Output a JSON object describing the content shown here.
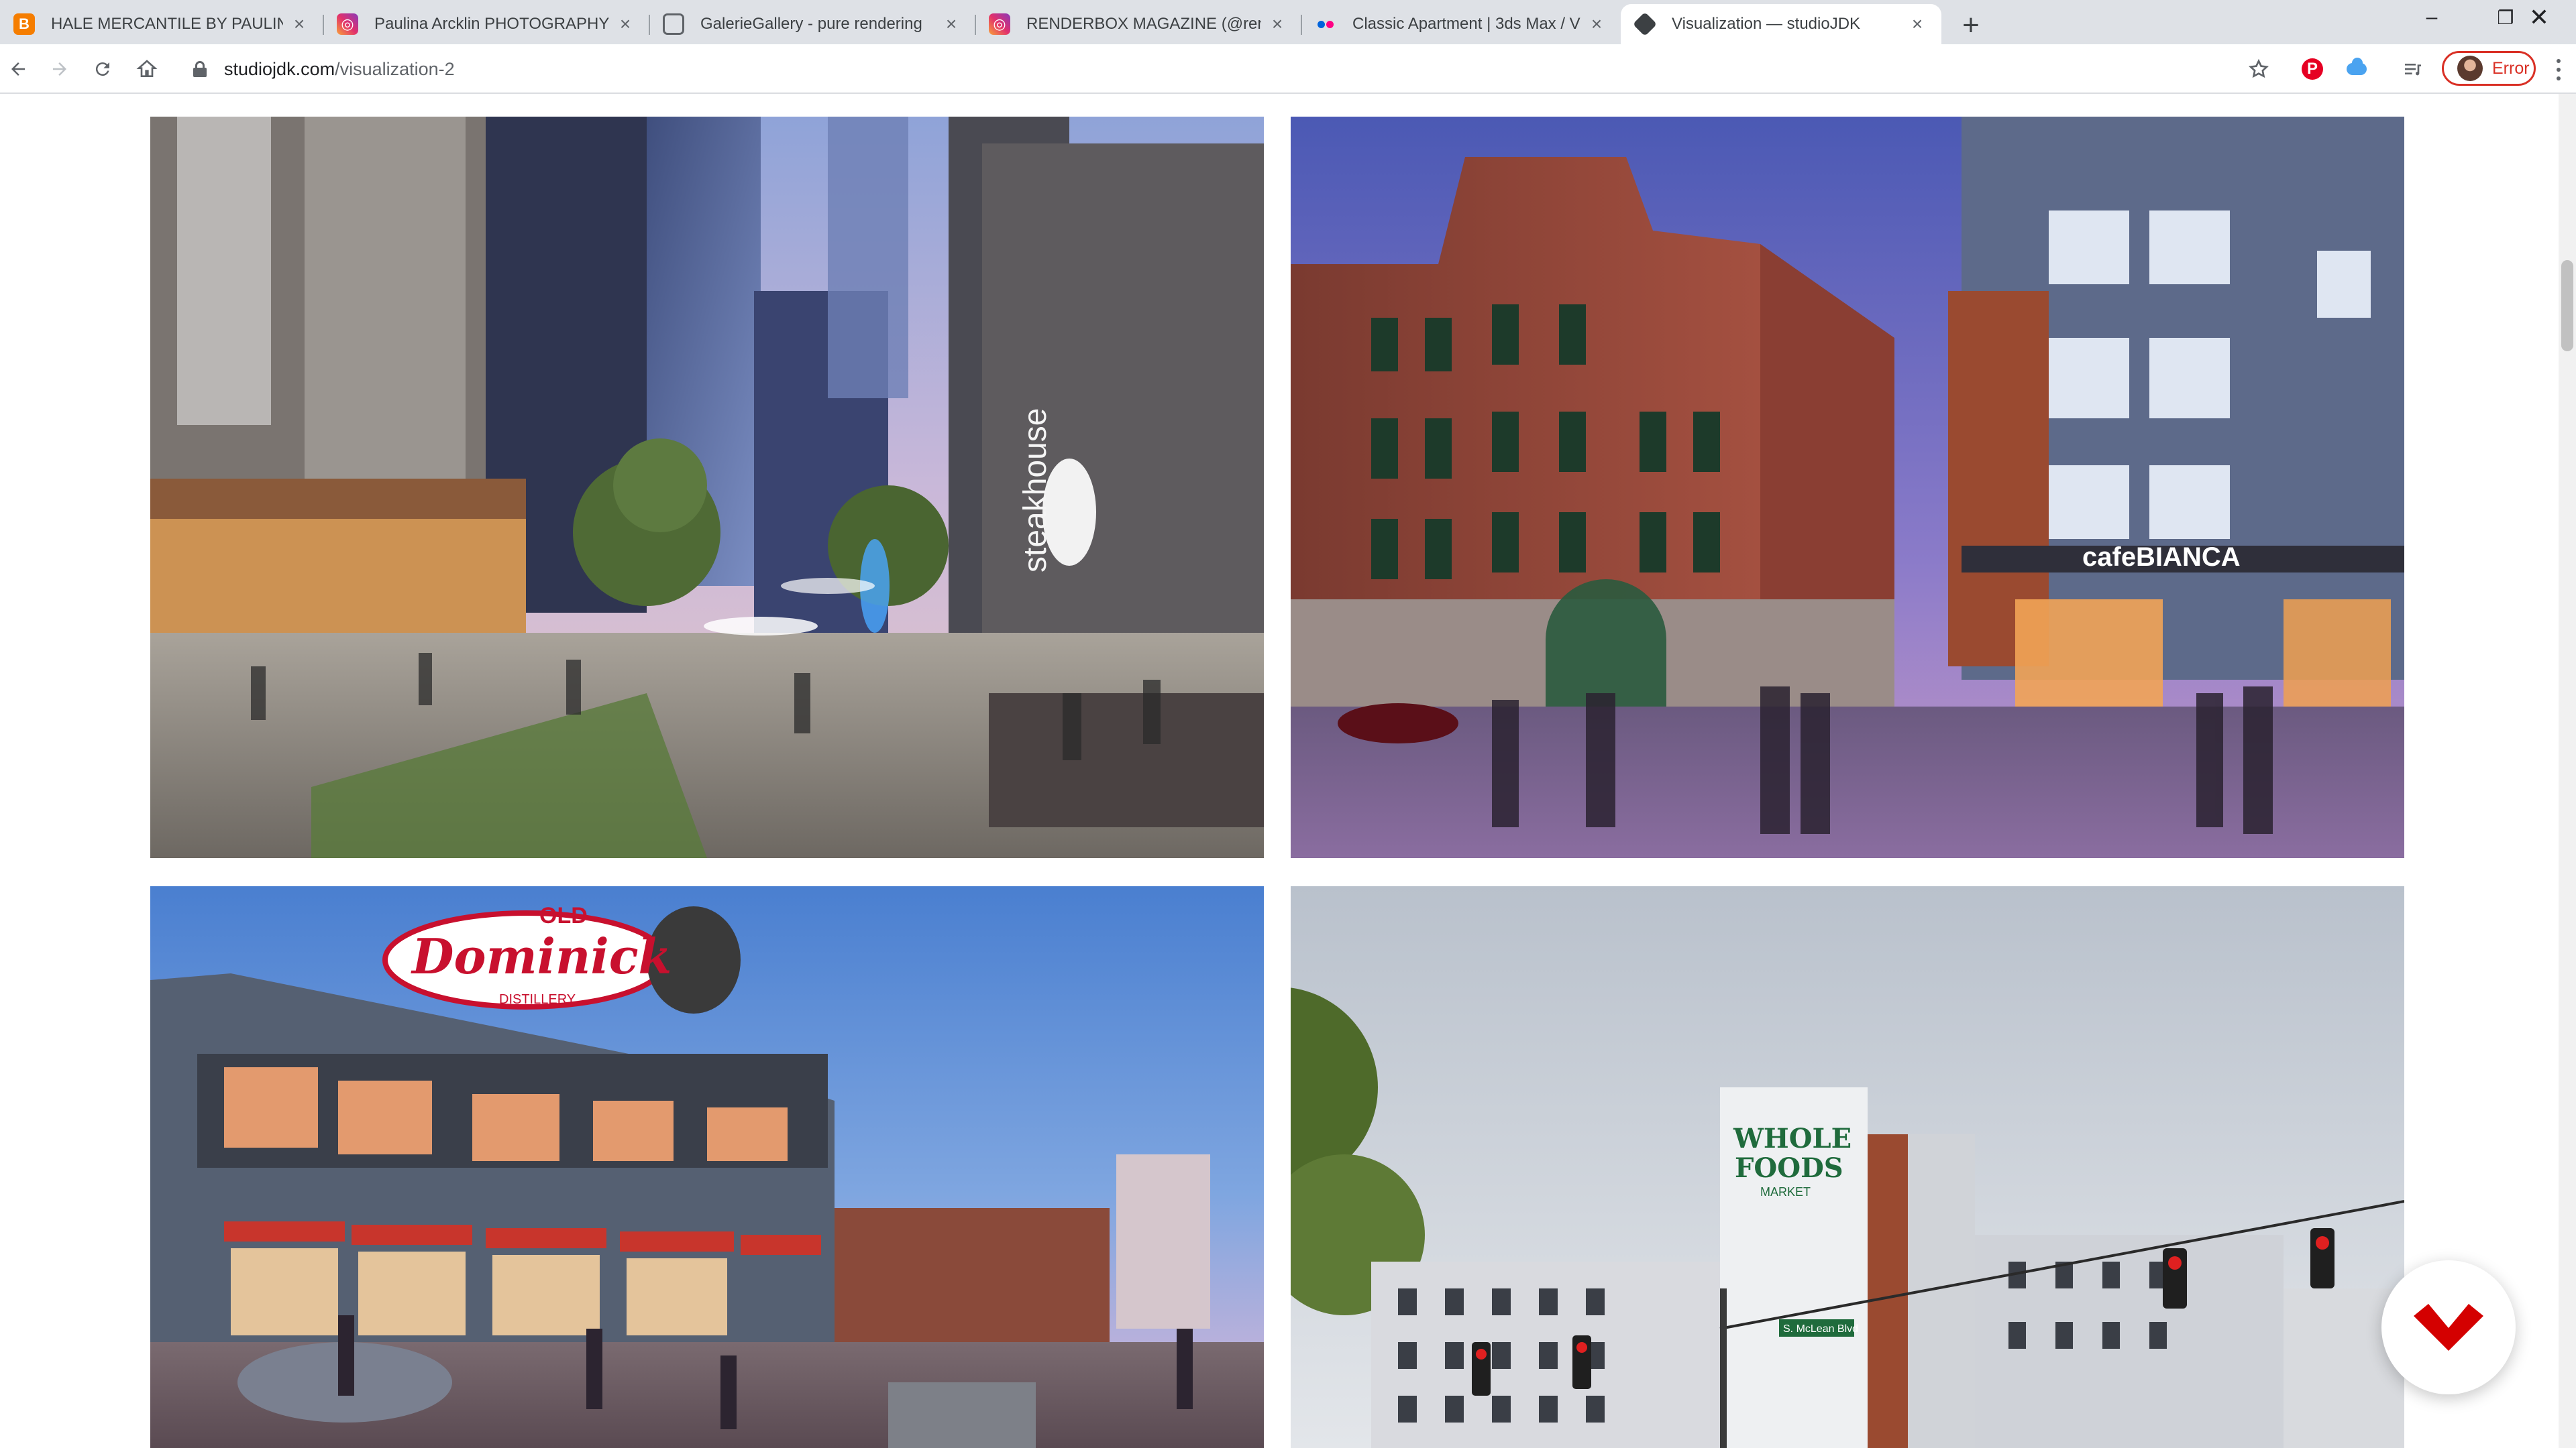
{
  "browser": {
    "tabs": [
      {
        "title": "HALE MERCANTILE BY PAULINA",
        "favicon": "blogger-icon"
      },
      {
        "title": "Paulina Arcklin PHOTOGRAPHY",
        "favicon": "instagram-icon"
      },
      {
        "title": "GalerieGallery - pure rendering",
        "favicon": "globe-icon"
      },
      {
        "title": "RENDERBOX MAGAZINE (@rend",
        "favicon": "instagram-icon"
      },
      {
        "title": "Classic Apartment | 3ds Max / V",
        "favicon": "flickr-icon"
      },
      {
        "title": "Visualization — studioJDK",
        "favicon": "squarespace-icon",
        "active": true
      }
    ],
    "url_host": "studiojdk.com",
    "url_path": "/visualization-2",
    "profile_status": "Error"
  },
  "gallery": {
    "images": [
      {
        "name": "steakhouse-plaza-rendering",
        "sign": "steakhouse"
      },
      {
        "name": "cafe-bianca-street-rendering",
        "sign": "cafeBIANCA"
      },
      {
        "name": "old-dominick-distillery-rendering",
        "sign_top": "OLD",
        "sign_main": "Dominick",
        "sign_small": "DISTILLERY"
      },
      {
        "name": "whole-foods-apartments-rendering",
        "sign_lines": [
          "WHOLE",
          "FOODS"
        ],
        "sign_small": "MARKET",
        "street_sign": "S. McLean Blvd"
      }
    ]
  },
  "colors": {
    "accent": "#d93025",
    "fab": "#d40000",
    "pinterest": "#e60023"
  }
}
